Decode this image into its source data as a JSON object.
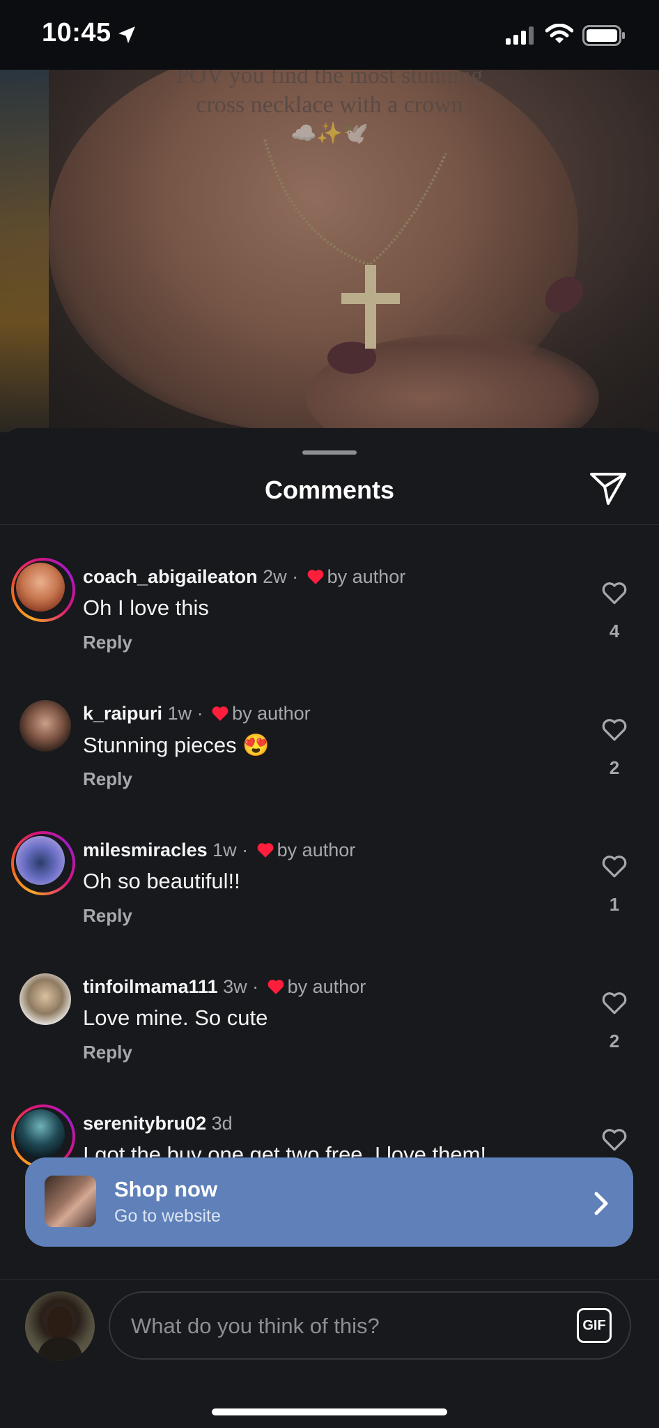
{
  "status_bar": {
    "time": "10:45"
  },
  "video": {
    "overlay_line1": "POV you find the most stunning",
    "overlay_line2": "cross necklace with a crown",
    "overlay_emojis": "☁️✨🕊️"
  },
  "sheet": {
    "title": "Comments"
  },
  "comments": [
    {
      "user": "coach_abigaileaton",
      "age": "2w",
      "liked_by": "by author",
      "text": "Oh I love this",
      "reply": "Reply",
      "likes": "4",
      "ring": true
    },
    {
      "user": "k_raipuri",
      "age": "1w",
      "liked_by": "by author",
      "text": "Stunning pieces 😍",
      "reply": "Reply",
      "likes": "2",
      "ring": false
    },
    {
      "user": "milesmiracles",
      "age": "1w",
      "liked_by": "by author",
      "text": "Oh so beautiful!!",
      "reply": "Reply",
      "likes": "1",
      "ring": true
    },
    {
      "user": "tinfoilmama111",
      "age": "3w",
      "liked_by": "by author",
      "text": "Love mine. So cute",
      "reply": "Reply",
      "likes": "2",
      "ring": false
    },
    {
      "user": "serenitybru02",
      "age": "3d",
      "text": "I got the buy one get two free. I love them!",
      "ring": true
    }
  ],
  "shop": {
    "title": "Shop now",
    "subtitle": "Go to website"
  },
  "composer": {
    "placeholder": "What do you think of this?",
    "gif_label": "GIF"
  },
  "colors": {
    "accent_shop": "#5f80b9",
    "heart_red": "#ff1f3d",
    "background": "#17191c"
  },
  "icons": [
    "location-arrow-icon",
    "signal-icon",
    "wifi-icon",
    "battery-icon",
    "send-icon",
    "heart-icon",
    "chevron-right-icon",
    "gif-icon"
  ]
}
